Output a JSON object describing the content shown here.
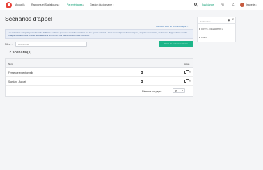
{
  "nav": {
    "home": "Accueil",
    "reports": "Rapports et Statistiques",
    "settings": "Paramétrages",
    "domain": "Gestion du domaine",
    "assistance": "Assistance",
    "lang": "FR",
    "user": "Isabelle"
  },
  "page": {
    "title": "Scénarios d'appel",
    "help_link": "Comment créer un scénario d'appel ?",
    "info": "Les scénarios d'appels permettent de définir les actions que vous souhaitez réaliser sur les appels entrants. Vous pouvez jouer des musiques, appeler un numéro, déclencher l'appel dans une file... Chaque scénario peut ensuite être affecté à un numéro via l'administration des numéros."
  },
  "filter": {
    "label": "Filtrer :",
    "placeholder": "Rechercher"
  },
  "create_button": "Créer un nouveau scénario",
  "count_title": "2 scénario(s)",
  "table": {
    "col_name": "Nom",
    "col_action": "Action",
    "rows": [
      {
        "name": "Fermeture exceptionnelle"
      },
      {
        "name": "Standard - Accueil"
      }
    ]
  },
  "pager": {
    "label": "Éléments par page :",
    "value": "25"
  },
  "side_panel": {
    "search_placeholder": "Rechercher",
    "line1": "POSTE - 33123456789",
    "line2": "Profil"
  },
  "icons": [
    "logo-icon",
    "search-icon",
    "bell-icon",
    "eye-icon",
    "copy-icon",
    "edit-icon",
    "pin-icon",
    "phone-icon"
  ],
  "colors": {
    "accent": "#1db589",
    "brand": "#e8433a",
    "info_text": "#3b5b8d",
    "info_bg": "#e9eef7"
  }
}
